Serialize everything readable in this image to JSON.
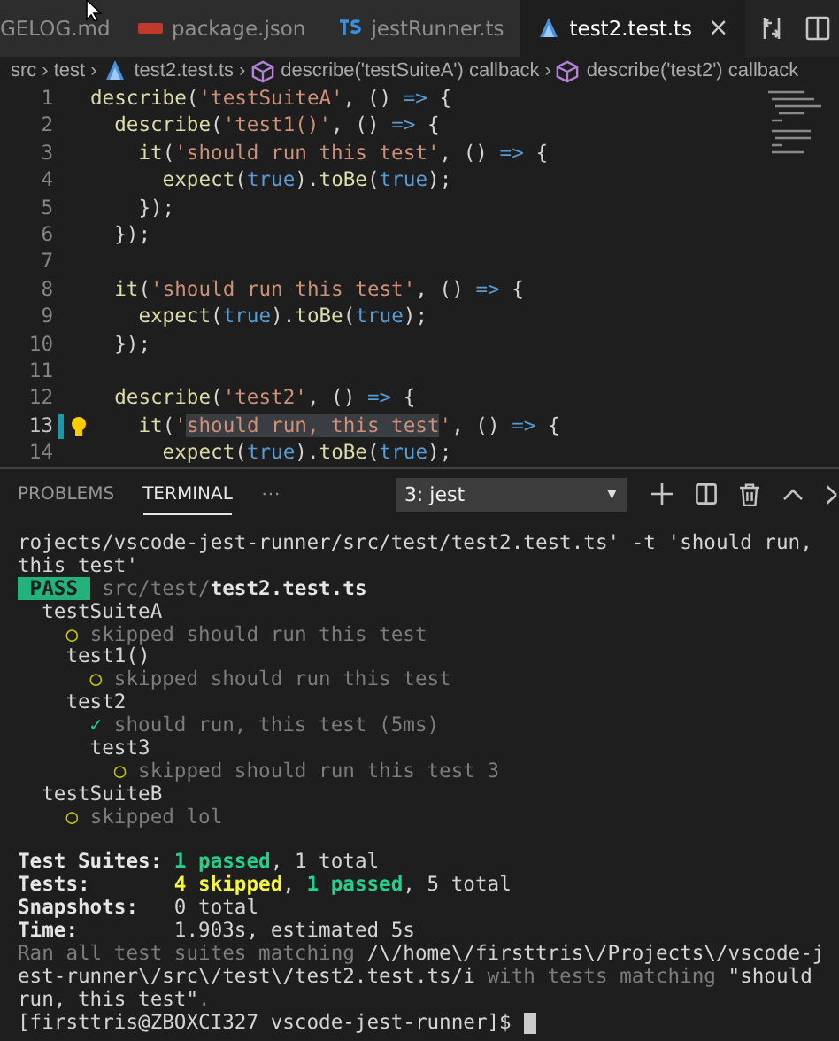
{
  "tabs": [
    {
      "label": "GELOG.md",
      "kind": "plain",
      "selected": false,
      "closable": false
    },
    {
      "label": "package.json",
      "kind": "json",
      "selected": false,
      "closable": false
    },
    {
      "label": "jestRunner.ts",
      "kind": "ts",
      "selected": false,
      "closable": false
    },
    {
      "label": "test2.test.ts",
      "kind": "jest",
      "selected": true,
      "closable": true
    }
  ],
  "tab_close": "×",
  "breadcrumb": [
    {
      "label": "src",
      "kind": "plain"
    },
    {
      "sep": "›",
      "label": "test",
      "kind": "plain"
    },
    {
      "sep": "›",
      "label": "test2.test.ts",
      "kind": "jest"
    },
    {
      "sep": "›",
      "label": "describe('testSuiteA') callback",
      "kind": "symbol"
    },
    {
      "sep": "›",
      "label": "describe('test2') callback",
      "kind": "symbol"
    }
  ],
  "editor": {
    "lines": [
      {
        "number": "1",
        "modified": false,
        "lightbulb": false,
        "tokens": [
          {
            "kind": "fn",
            "text": "describe"
          },
          {
            "kind": "punc",
            "text": "("
          },
          {
            "kind": "str",
            "text": "'testSuiteA'"
          },
          {
            "kind": "punc",
            "text": ", () "
          },
          {
            "kind": "kw",
            "text": "=>"
          },
          {
            "kind": "punc",
            "text": " {"
          }
        ]
      },
      {
        "number": "2",
        "modified": false,
        "lightbulb": false,
        "tokens": [
          {
            "kind": "fn",
            "text": "  describe"
          },
          {
            "kind": "punc",
            "text": "("
          },
          {
            "kind": "str",
            "text": "'test1()'"
          },
          {
            "kind": "punc",
            "text": ", () "
          },
          {
            "kind": "kw",
            "text": "=>"
          },
          {
            "kind": "punc",
            "text": " {"
          }
        ]
      },
      {
        "number": "3",
        "modified": false,
        "lightbulb": false,
        "tokens": [
          {
            "kind": "fn",
            "text": "    it"
          },
          {
            "kind": "punc",
            "text": "("
          },
          {
            "kind": "str",
            "text": "'should run this test'"
          },
          {
            "kind": "punc",
            "text": ", () "
          },
          {
            "kind": "kw",
            "text": "=>"
          },
          {
            "kind": "punc",
            "text": " {"
          }
        ]
      },
      {
        "number": "4",
        "modified": false,
        "lightbulb": false,
        "tokens": [
          {
            "kind": "fn",
            "text": "      expect"
          },
          {
            "kind": "punc",
            "text": "("
          },
          {
            "kind": "kw",
            "text": "true"
          },
          {
            "kind": "punc",
            "text": ")."
          },
          {
            "kind": "fn",
            "text": "toBe"
          },
          {
            "kind": "punc",
            "text": "("
          },
          {
            "kind": "kw",
            "text": "true"
          },
          {
            "kind": "punc",
            "text": ");"
          }
        ]
      },
      {
        "number": "5",
        "modified": false,
        "lightbulb": false,
        "tokens": [
          {
            "kind": "punc",
            "text": "    });"
          }
        ]
      },
      {
        "number": "6",
        "modified": false,
        "lightbulb": false,
        "tokens": [
          {
            "kind": "punc",
            "text": "  });"
          }
        ]
      },
      {
        "number": "7",
        "modified": false,
        "lightbulb": false
      },
      {
        "number": "8",
        "modified": false,
        "lightbulb": false,
        "tokens": [
          {
            "kind": "fn",
            "text": "  it"
          },
          {
            "kind": "punc",
            "text": "("
          },
          {
            "kind": "str",
            "text": "'should run this test'"
          },
          {
            "kind": "punc",
            "text": ", () "
          },
          {
            "kind": "kw",
            "text": "=>"
          },
          {
            "kind": "punc",
            "text": " {"
          }
        ]
      },
      {
        "number": "9",
        "modified": false,
        "lightbulb": false,
        "tokens": [
          {
            "kind": "fn",
            "text": "    expect"
          },
          {
            "kind": "punc",
            "text": "("
          },
          {
            "kind": "kw",
            "text": "true"
          },
          {
            "kind": "punc",
            "text": ")."
          },
          {
            "kind": "fn",
            "text": "toBe"
          },
          {
            "kind": "punc",
            "text": "("
          },
          {
            "kind": "kw",
            "text": "true"
          },
          {
            "kind": "punc",
            "text": ");"
          }
        ]
      },
      {
        "number": "10",
        "modified": false,
        "lightbulb": false,
        "tokens": [
          {
            "kind": "punc",
            "text": "  });"
          }
        ]
      },
      {
        "number": "11",
        "modified": false,
        "lightbulb": false
      },
      {
        "number": "12",
        "modified": false,
        "lightbulb": false,
        "tokens": [
          {
            "kind": "fn",
            "text": "  describe"
          },
          {
            "kind": "punc",
            "text": "("
          },
          {
            "kind": "str",
            "text": "'test2'"
          },
          {
            "kind": "punc",
            "text": ", () "
          },
          {
            "kind": "kw",
            "text": "=>"
          },
          {
            "kind": "punc",
            "text": " {"
          }
        ]
      },
      {
        "number": "13",
        "modified": true,
        "lightbulb": true,
        "tokens": [
          {
            "kind": "fn",
            "text": "    it"
          },
          {
            "kind": "punc",
            "text": "("
          },
          {
            "kind": "str",
            "text": "'"
          },
          {
            "kind": "sel",
            "text": "should run, this test"
          },
          {
            "kind": "str",
            "text": "'"
          },
          {
            "kind": "punc",
            "text": ", () "
          },
          {
            "kind": "kw",
            "text": "=>"
          },
          {
            "kind": "punc",
            "text": " {"
          }
        ]
      },
      {
        "number": "14",
        "modified": false,
        "lightbulb": false,
        "tokens": [
          {
            "kind": "fn",
            "text": "      expect"
          },
          {
            "kind": "punc",
            "text": "("
          },
          {
            "kind": "kw",
            "text": "true"
          },
          {
            "kind": "punc",
            "text": ")."
          },
          {
            "kind": "fn",
            "text": "toBe"
          },
          {
            "kind": "punc",
            "text": "("
          },
          {
            "kind": "kw",
            "text": "true"
          },
          {
            "kind": "punc",
            "text": ");"
          }
        ]
      }
    ]
  },
  "panel": {
    "tabs": [
      {
        "label": "PROBLEMS",
        "selected": false
      },
      {
        "label": "TERMINAL",
        "selected": true
      }
    ],
    "more": "···",
    "terminal_select": "3: jest",
    "dropdown_caret": "▼"
  },
  "terminal": {
    "output": [
      [
        {
          "kind": "plain",
          "text": "rojects/vscode-jest-runner/src/test/test2.test.ts' -t 'should run,"
        }
      ],
      [
        {
          "kind": "plain",
          "text": "this test'"
        }
      ],
      [
        {
          "kind": "badge",
          "text": " PASS "
        },
        {
          "kind": "dim",
          "text": " src/test/"
        },
        {
          "kind": "bold",
          "text": "test2.test.ts"
        }
      ],
      [
        {
          "kind": "plain",
          "text": "  testSuiteA"
        }
      ],
      [
        {
          "kind": "yellow",
          "text": "    ○"
        },
        {
          "kind": "dim",
          "text": " skipped should run this test"
        }
      ],
      [
        {
          "kind": "plain",
          "text": "    test1()"
        }
      ],
      [
        {
          "kind": "yellow",
          "text": "      ○"
        },
        {
          "kind": "dim",
          "text": " skipped should run this test"
        }
      ],
      [
        {
          "kind": "plain",
          "text": "    test2"
        }
      ],
      [
        {
          "kind": "green",
          "text": "      ✓"
        },
        {
          "kind": "dim",
          "text": " should run, this test (5ms)"
        }
      ],
      [
        {
          "kind": "plain",
          "text": "      test3"
        }
      ],
      [
        {
          "kind": "yellow",
          "text": "        ○"
        },
        {
          "kind": "dim",
          "text": " skipped should run this test 3"
        }
      ],
      [
        {
          "kind": "plain",
          "text": "  testSuiteB"
        }
      ],
      [
        {
          "kind": "yellow",
          "text": "    ○"
        },
        {
          "kind": "dim",
          "text": " skipped lol"
        }
      ]
    ],
    "summary": [
      [
        {
          "kind": "bold",
          "text": "Test Suites: "
        },
        {
          "kind": "greenbold",
          "text": "1 passed"
        },
        {
          "kind": "plain",
          "text": ", 1 total"
        }
      ],
      [
        {
          "kind": "bold",
          "text": "Tests:       "
        },
        {
          "kind": "yellowbold",
          "text": "4 skipped"
        },
        {
          "kind": "plain",
          "text": ", "
        },
        {
          "kind": "greenbold",
          "text": "1 passed"
        },
        {
          "kind": "plain",
          "text": ", 5 total"
        }
      ],
      [
        {
          "kind": "bold",
          "text": "Snapshots:   "
        },
        {
          "kind": "plain",
          "text": "0 total"
        }
      ],
      [
        {
          "kind": "bold",
          "text": "Time:        "
        },
        {
          "kind": "plain",
          "text": "1.903s, estimated 5s"
        }
      ],
      [
        {
          "kind": "dim",
          "text": "Ran all test suites matching "
        },
        {
          "kind": "plain",
          "text": "/\\/home\\/firsttris\\/Projects\\/vscode-j"
        }
      ],
      [
        {
          "kind": "plain",
          "text": "est-runner\\/src\\/test\\/test2.test.ts/i"
        },
        {
          "kind": "dim",
          "text": " with tests matching "
        },
        {
          "kind": "plain",
          "text": "\"should"
        }
      ],
      [
        {
          "kind": "plain",
          "text": "run, this test\""
        },
        {
          "kind": "dim",
          "text": "."
        }
      ]
    ],
    "prompt": "[firsttris@ZBOXCI327 vscode-jest-runner]$ ",
    "cursor": true
  }
}
